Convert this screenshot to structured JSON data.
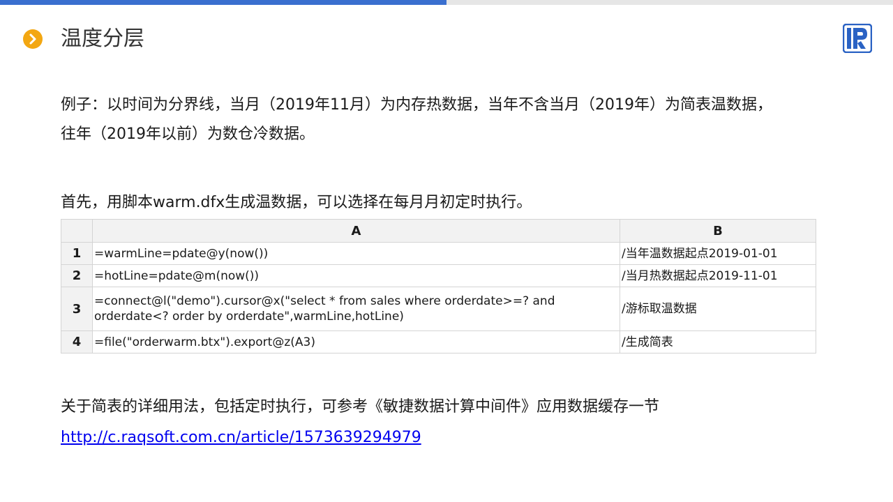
{
  "header": {
    "title": "温度分层",
    "accent_color": "#3a6fcf",
    "icon_color": "#f3a712",
    "bullet_icon": "chevron-right-icon",
    "logo_icon": "raqsoft-r-logo-icon"
  },
  "content": {
    "paragraph1_line1": "例子：以时间为分界线，当月（2019年11月）为内存热数据，当年不含当月（2019年）为简表温数据，",
    "paragraph1_line2": "往年（2019年以前）为数仓冷数据。",
    "paragraph2": "首先，用脚本warm.dfx生成温数据，可以选择在每月月初定时执行。",
    "paragraph3": "关于简表的详细用法，包括定时执行，可参考《敏捷数据计算中间件》应用数据缓存一节",
    "link": "http://c.raqsoft.com.cn/article/1573639294979"
  },
  "table": {
    "columns": [
      "A",
      "B"
    ],
    "rows": [
      {
        "num": "1",
        "a": "=warmLine=pdate@y(now())",
        "b": "/当年温数据起点2019-01-01"
      },
      {
        "num": "2",
        "a": "=hotLine=pdate@m(now())",
        "b": "/当月热数据起点2019-11-01"
      },
      {
        "num": "3",
        "a": "=connect@l(\"demo\").cursor@x(\"select * from sales  where orderdate>=? and orderdate<? order by orderdate\",warmLine,hotLine)",
        "b": "/游标取温数据"
      },
      {
        "num": "4",
        "a": "=file(\"orderwarm.btx\").export@z(A3)",
        "b": "/生成简表"
      }
    ]
  }
}
